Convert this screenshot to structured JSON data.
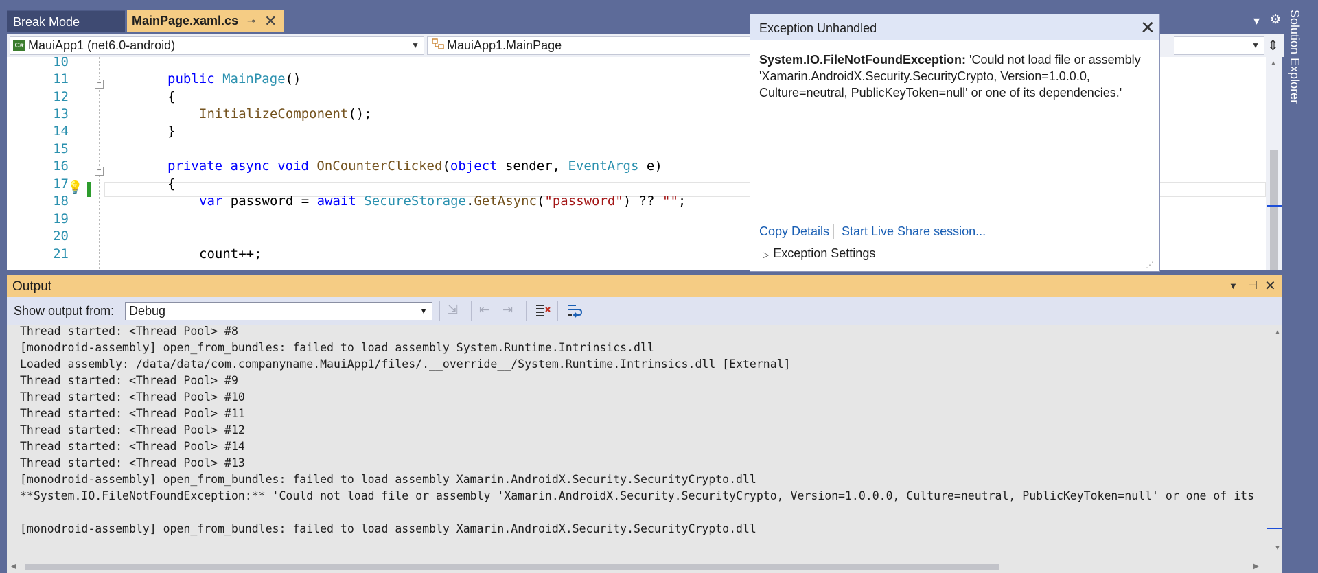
{
  "tabs": {
    "break_mode": "Break Mode",
    "main_page": "MainPage.xaml.cs",
    "pin_icon": "⊸",
    "close_icon": "✕"
  },
  "strip_tools": {
    "dropdown": "▾",
    "gear": "⚙"
  },
  "navbar": {
    "project": "MauiApp1 (net6.0-android)",
    "project_badge": "C#",
    "class": "MauiApp1.MainPage"
  },
  "editor": {
    "line_numbers": [
      "10",
      "11",
      "12",
      "13",
      "14",
      "15",
      "16",
      "17",
      "18",
      "19",
      "20",
      "21"
    ]
  },
  "exception": {
    "title": "Exception Unhandled",
    "type": "System.IO.FileNotFoundException:",
    "message": " 'Could not load file or assembly 'Xamarin.AndroidX.Security.SecurityCrypto, Version=1.0.0.0, Culture=neutral, PublicKeyToken=null' or one of its dependencies.'",
    "copy_details": "Copy Details",
    "live_share": "Start Live Share session...",
    "settings": "Exception Settings"
  },
  "output": {
    "title": "Output",
    "show_from_label": "Show output from:",
    "source": "Debug",
    "lines": [
      "Thread started: <Thread Pool> #8",
      "[monodroid-assembly] open_from_bundles: failed to load assembly System.Runtime.Intrinsics.dll",
      "Loaded assembly: /data/data/com.companyname.MauiApp1/files/.__override__/System.Runtime.Intrinsics.dll [External]",
      "Thread started: <Thread Pool> #9",
      "Thread started: <Thread Pool> #10",
      "Thread started: <Thread Pool> #11",
      "Thread started: <Thread Pool> #12",
      "Thread started: <Thread Pool> #14",
      "Thread started: <Thread Pool> #13",
      "[monodroid-assembly] open_from_bundles: failed to load assembly Xamarin.AndroidX.Security.SecurityCrypto.dll",
      "**System.IO.FileNotFoundException:** 'Could not load file or assembly 'Xamarin.AndroidX.Security.SecurityCrypto, Version=1.0.0.0, Culture=neutral, PublicKeyToken=null' or one of its",
      "",
      "[monodroid-assembly] open_from_bundles: failed to load assembly Xamarin.AndroidX.Security.SecurityCrypto.dll"
    ]
  },
  "sidebar": {
    "solution_explorer": "Solution Explorer"
  }
}
